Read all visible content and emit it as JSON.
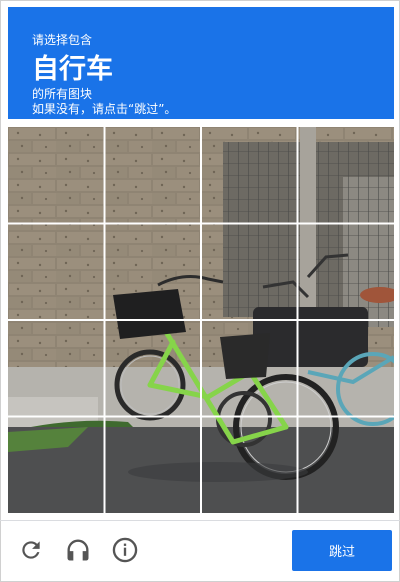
{
  "header": {
    "instruction": "请选择包含",
    "target": "自行车",
    "subtitle": "的所有图块",
    "hint": "如果没有，请点击“跳过”。",
    "color": "#1a73e8"
  },
  "grid": {
    "rows": 4,
    "cols": 4,
    "tiles": [
      {
        "row": 1,
        "col": 1
      },
      {
        "row": 1,
        "col": 2
      },
      {
        "row": 1,
        "col": 3
      },
      {
        "row": 1,
        "col": 4
      },
      {
        "row": 2,
        "col": 1
      },
      {
        "row": 2,
        "col": 2
      },
      {
        "row": 2,
        "col": 3
      },
      {
        "row": 2,
        "col": 4
      },
      {
        "row": 3,
        "col": 1
      },
      {
        "row": 3,
        "col": 2
      },
      {
        "row": 3,
        "col": 3
      },
      {
        "row": 3,
        "col": 4
      },
      {
        "row": 4,
        "col": 1
      },
      {
        "row": 4,
        "col": 2
      },
      {
        "row": 4,
        "col": 3
      },
      {
        "row": 4,
        "col": 4
      }
    ]
  },
  "footer": {
    "reload_icon": "reload-icon",
    "audio_icon": "headphones-icon",
    "info_icon": "info-icon",
    "skip_label": "跳过"
  }
}
